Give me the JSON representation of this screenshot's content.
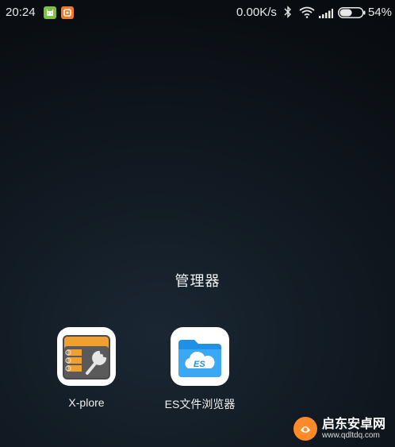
{
  "status_bar": {
    "time": "20:24",
    "network_speed": "0.00K/s",
    "battery": "54%",
    "icons": [
      "android-notification-icon",
      "orange-app-notification-icon",
      "bluetooth-icon",
      "wifi-icon",
      "signal-icon",
      "battery-icon"
    ],
    "battery_level": 0.54
  },
  "folder": {
    "title": "管理器",
    "apps": [
      {
        "label": "X-plore",
        "icon": "xplore-app-icon"
      },
      {
        "label": "ES文件浏览器",
        "icon": "es-file-explorer-icon"
      }
    ]
  },
  "watermark": {
    "title": "启东安卓网",
    "url": "www.qdltdq.com"
  },
  "colors": {
    "es_blue": "#1e90e6",
    "xplore_orange": "#f0a030",
    "android_green": "#7bc043",
    "watermark_orange": "#ff8a2a"
  }
}
